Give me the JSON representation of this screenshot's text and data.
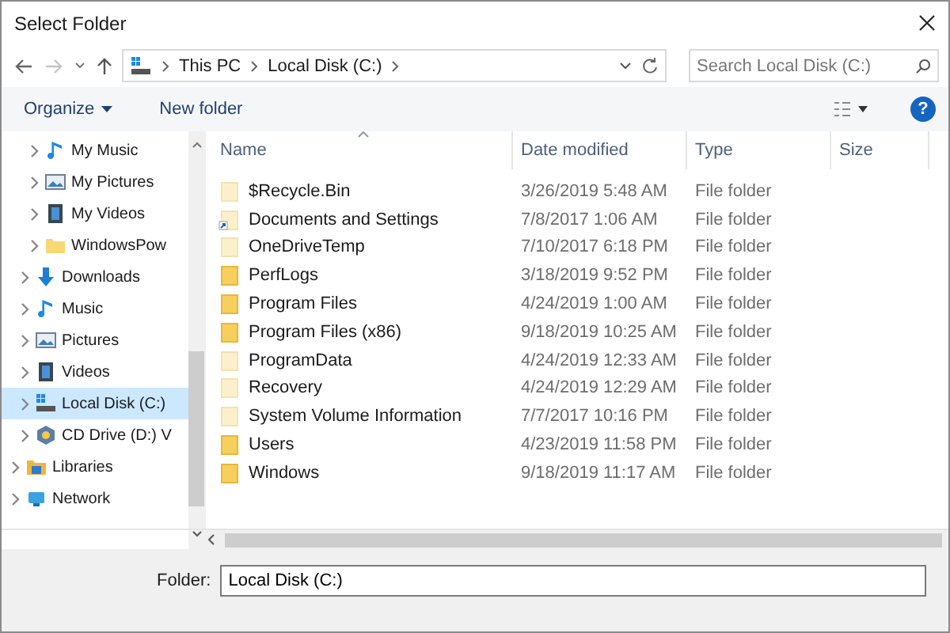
{
  "window": {
    "title": "Select Folder"
  },
  "address": {
    "path": [
      "This PC",
      "Local Disk (C:)"
    ]
  },
  "search": {
    "placeholder": "Search Local Disk (C:)"
  },
  "toolbar": {
    "organize": "Organize",
    "new_folder": "New folder",
    "help": "?"
  },
  "nav": {
    "items": [
      {
        "children": [
          {
            "children": [
              {
                "label": "My Music",
                "kind": "music",
                "selected": false
              },
              {
                "label": "My Pictures",
                "kind": "pictures",
                "selected": false
              },
              {
                "label": "My Videos",
                "kind": "videos",
                "selected": false
              },
              {
                "label": "WindowsPow",
                "kind": "folder",
                "selected": false
              }
            ]
          },
          {
            "label": "Downloads",
            "kind": "download",
            "selected": false
          },
          {
            "label": "Music",
            "kind": "music",
            "selected": false
          },
          {
            "label": "Pictures",
            "kind": "pictures",
            "selected": false
          },
          {
            "label": "Videos",
            "kind": "videos",
            "selected": false
          },
          {
            "label": "Local Disk (C:)",
            "kind": "drive",
            "selected": true
          },
          {
            "label": "CD Drive (D:) V",
            "kind": "cd",
            "selected": false
          }
        ]
      },
      {
        "label": "Libraries",
        "kind": "libraries",
        "selected": false
      },
      {
        "label": "Network",
        "kind": "network",
        "selected": false
      }
    ]
  },
  "columns": [
    {
      "label": "Name",
      "sorted": true
    },
    {
      "label": "Date modified",
      "sorted": false
    },
    {
      "label": "Type",
      "sorted": false
    },
    {
      "label": "Size",
      "sorted": false
    }
  ],
  "files": [
    {
      "name": "$Recycle.Bin",
      "date": "3/26/2019 5:48 AM",
      "type": "File folder",
      "hidden": true,
      "shortcut": false
    },
    {
      "name": "Documents and Settings",
      "date": "7/8/2017 1:06 AM",
      "type": "File folder",
      "hidden": true,
      "shortcut": true
    },
    {
      "name": "OneDriveTemp",
      "date": "7/10/2017 6:18 PM",
      "type": "File folder",
      "hidden": true,
      "shortcut": false
    },
    {
      "name": "PerfLogs",
      "date": "3/18/2019 9:52 PM",
      "type": "File folder",
      "hidden": false,
      "shortcut": false
    },
    {
      "name": "Program Files",
      "date": "4/24/2019 1:00 AM",
      "type": "File folder",
      "hidden": false,
      "shortcut": false
    },
    {
      "name": "Program Files (x86)",
      "date": "9/18/2019 10:25 AM",
      "type": "File folder",
      "hidden": false,
      "shortcut": false
    },
    {
      "name": "ProgramData",
      "date": "4/24/2019 12:33 AM",
      "type": "File folder",
      "hidden": true,
      "shortcut": false
    },
    {
      "name": "Recovery",
      "date": "4/24/2019 12:29 AM",
      "type": "File folder",
      "hidden": true,
      "shortcut": false
    },
    {
      "name": "System Volume Information",
      "date": "7/7/2017 10:16 PM",
      "type": "File folder",
      "hidden": true,
      "shortcut": false
    },
    {
      "name": "Users",
      "date": "4/23/2019 11:58 PM",
      "type": "File folder",
      "hidden": false,
      "shortcut": false
    },
    {
      "name": "Windows",
      "date": "9/18/2019 11:17 AM",
      "type": "File folder",
      "hidden": false,
      "shortcut": false
    }
  ],
  "folder": {
    "label": "Folder:",
    "value": "Local Disk (C:)"
  }
}
